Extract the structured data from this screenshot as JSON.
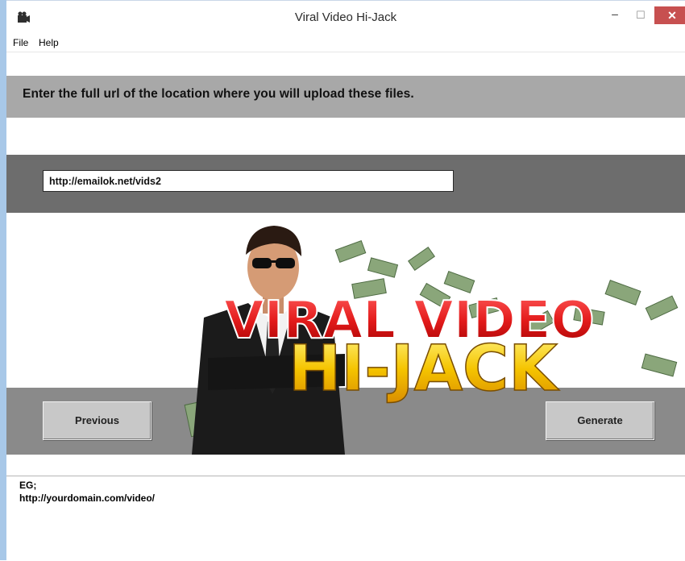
{
  "window": {
    "title": "Viral Video Hi-Jack",
    "controls": {
      "minimize": "–",
      "maximize": "☐",
      "close": "✕"
    }
  },
  "menu": {
    "items": [
      "File",
      "Help"
    ]
  },
  "instruction": "Enter the full url of the location where you will upload these files.",
  "url_field": {
    "value": "http://emailok.net/vids2"
  },
  "banner": {
    "line1": "VIRAL VIDEO",
    "line2": "HI-JACK"
  },
  "buttons": {
    "previous": "Previous",
    "generate": "Generate"
  },
  "example": {
    "label": "EG;",
    "url": "http://yourdomain.com/video/"
  },
  "colors": {
    "instruction_band": "#a8a8a8",
    "url_band": "#6d6d6d",
    "close_button": "#c75050",
    "banner_red": "#e31b1b",
    "banner_gold": "#f5c400"
  }
}
